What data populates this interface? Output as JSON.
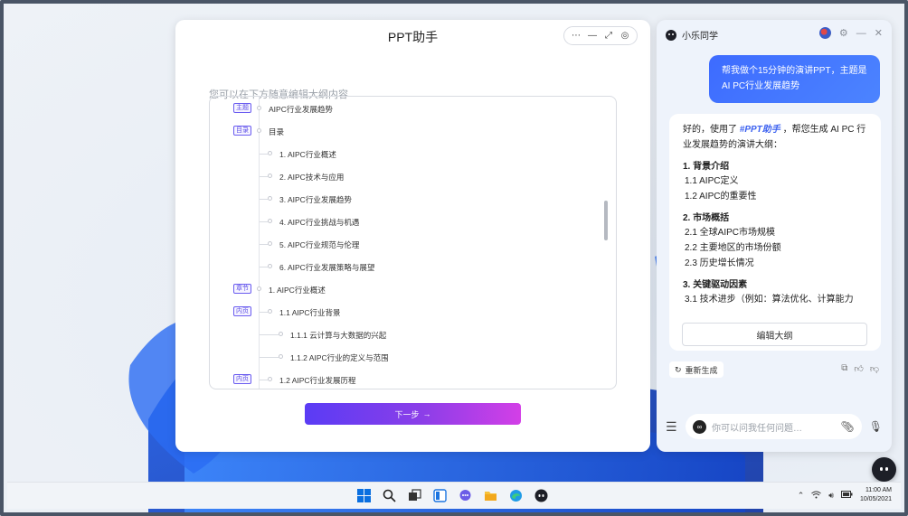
{
  "ppt": {
    "title": "PPT助手",
    "controls": [
      "⋯",
      "—",
      "⤢",
      "◎"
    ],
    "hint": "您可以在下方随意编辑大纲内容",
    "outline": [
      {
        "tag": "主题",
        "text": "AIPC行业发展趋势",
        "level": 0
      },
      {
        "tag": "目录",
        "text": "目录",
        "level": 0
      },
      {
        "tag": "",
        "text": "1. AIPC行业概述",
        "level": 1
      },
      {
        "tag": "",
        "text": "2. AIPC技术与应用",
        "level": 1
      },
      {
        "tag": "",
        "text": "3. AIPC行业发展趋势",
        "level": 1
      },
      {
        "tag": "",
        "text": "4. AIPC行业挑战与机遇",
        "level": 1
      },
      {
        "tag": "",
        "text": "5. AIPC行业规范与伦理",
        "level": 1
      },
      {
        "tag": "",
        "text": "6. AIPC行业发展策略与展望",
        "level": 1
      },
      {
        "tag": "章节",
        "text": "1. AIPC行业概述",
        "level": 0
      },
      {
        "tag": "内页",
        "text": "1.1 AIPC行业背景",
        "level": 1
      },
      {
        "tag": "",
        "text": "1.1.1 云计算与大数据的兴起",
        "level": 2
      },
      {
        "tag": "",
        "text": "1.1.2 AIPC行业的定义与范围",
        "level": 2
      },
      {
        "tag": "内页",
        "text": "1.2 AIPC行业发展历程",
        "level": 1
      }
    ],
    "next_label": "下一步",
    "next_arrow": "→"
  },
  "assistant": {
    "name": "小乐同学",
    "user_message": "帮我做个15分钟的演讲PPT，主题是AI PC行业发展趋势",
    "reply_prefix": "好的，使用了",
    "reply_highlight": "#PPT助手",
    "reply_suffix": "，帮您生成 AI PC 行业发展趋势的演讲大纲：",
    "sections": [
      {
        "title": "1. 背景介绍",
        "items": [
          "1.1 AIPC定义",
          "1.2 AIPC的重要性"
        ]
      },
      {
        "title": "2. 市场概括",
        "items": [
          "2.1 全球AIPC市场规模",
          "2.2 主要地区的市场份额",
          "2.3 历史增长情况"
        ]
      },
      {
        "title": "3. 关键驱动因素",
        "items": [
          "3.1 技术进步（例如：算法优化、计算能力"
        ]
      }
    ],
    "edit_label": "编辑大纲",
    "regen_label": "重新生成",
    "input_placeholder": "你可以问我任何问题…"
  },
  "taskbar": {
    "time": "11:00 AM",
    "date": "10/05/2021"
  }
}
